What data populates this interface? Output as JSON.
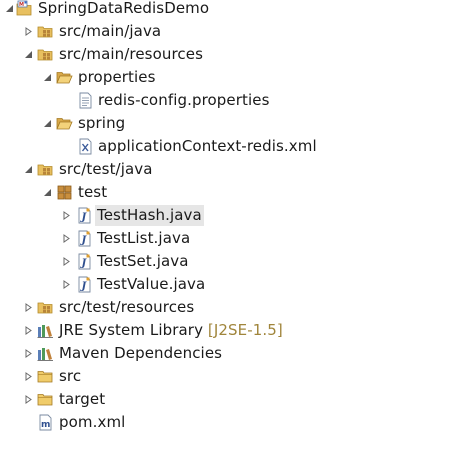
{
  "tree": {
    "project": {
      "label": "SpringDataRedisDemo",
      "icon": "maven-project-icon",
      "expanded": true
    },
    "src_main_java": {
      "label": "src/main/java",
      "icon": "source-folder-icon",
      "expanded": false
    },
    "src_main_resources": {
      "label": "src/main/resources",
      "icon": "source-folder-icon",
      "expanded": true
    },
    "properties_folder": {
      "label": "properties",
      "icon": "folder-open-icon",
      "expanded": true
    },
    "redis_config": {
      "label": "redis-config.properties",
      "icon": "properties-file-icon"
    },
    "spring_folder": {
      "label": "spring",
      "icon": "folder-open-icon",
      "expanded": true
    },
    "app_context": {
      "label": "applicationContext-redis.xml",
      "icon": "xml-file-icon"
    },
    "src_test_java": {
      "label": "src/test/java",
      "icon": "source-folder-icon",
      "expanded": true
    },
    "test_package": {
      "label": "test",
      "icon": "package-icon",
      "expanded": true
    },
    "test_hash": {
      "label": "TestHash.java",
      "icon": "java-file-icon",
      "selected": true
    },
    "test_list": {
      "label": "TestList.java",
      "icon": "java-file-icon"
    },
    "test_set": {
      "label": "TestSet.java",
      "icon": "java-file-icon"
    },
    "test_value": {
      "label": "TestValue.java",
      "icon": "java-file-icon"
    },
    "src_test_resources": {
      "label": "src/test/resources",
      "icon": "source-folder-icon",
      "expanded": false
    },
    "jre_library": {
      "label": "JRE System Library",
      "decoration": "[J2SE-1.5]",
      "icon": "library-icon",
      "expanded": false
    },
    "maven_deps": {
      "label": "Maven Dependencies",
      "icon": "library-icon",
      "expanded": false
    },
    "src_folder": {
      "label": "src",
      "icon": "folder-closed-icon",
      "expanded": false
    },
    "target_folder": {
      "label": "target",
      "icon": "folder-closed-icon",
      "expanded": false
    },
    "pom": {
      "label": "pom.xml",
      "icon": "maven-pom-icon"
    }
  },
  "colors": {
    "selection": "#e6e6e6",
    "decoration": "#a0853b",
    "folder": "#e8c060",
    "package": "#b8853a",
    "java": "#6b8fc9"
  }
}
